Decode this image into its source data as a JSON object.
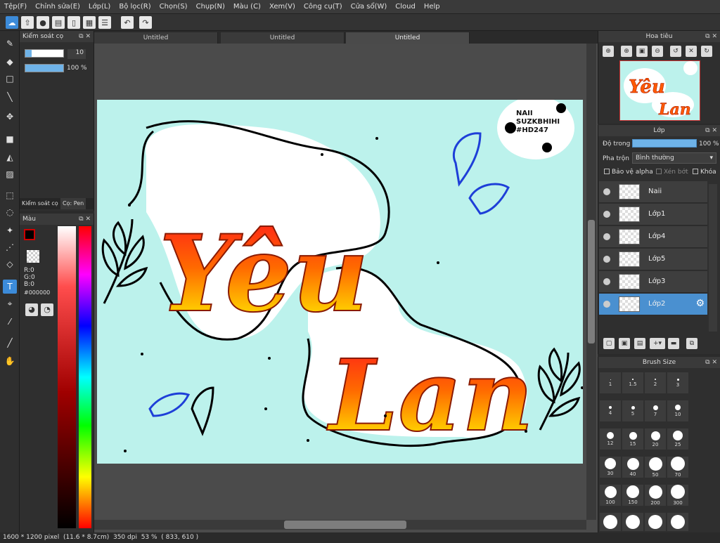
{
  "menu": [
    "Tệp(F)",
    "Chỉnh sửa(E)",
    "Lớp(L)",
    "Bộ lọc(R)",
    "Chọn(S)",
    "Chụp(N)",
    "Màu (C)",
    "Xem(V)",
    "Công cụ(T)",
    "Cửa sổ(W)",
    "Cloud",
    "Help"
  ],
  "toolbar": {
    "undo_icon": "undo-arrow-icon",
    "redo_icon": "redo-arrow-icon"
  },
  "brush_control": {
    "title": "Kiểm soát cọ",
    "size_value": "10",
    "opacity_value": "100 %",
    "tabs": [
      "Kiểm soát cọ",
      "Cọ: Pen"
    ]
  },
  "color_panel": {
    "title": "Màu",
    "r": "R:0",
    "g": "G:0",
    "b": "B:0",
    "hex": "#000000",
    "fg_color": "#000000",
    "bg_color": "#ffffff"
  },
  "document_tabs": [
    "Untitled",
    "Untitled",
    "Untitled"
  ],
  "artwork": {
    "title_line1": "Yêu",
    "title_line2": "Lan",
    "signature_line1": "NAII",
    "signature_line2": "SUZKBHIHI",
    "signature_line3": "#HD247"
  },
  "status": {
    "pixels": "1600 * 1200 pixel",
    "size_cm": "(11.6 * 8.7cm)",
    "dpi": "350 dpi",
    "zoom": "53 %",
    "cursor": "( 833, 610 )"
  },
  "navigator": {
    "title": "Hoa tiêu"
  },
  "layer_panel": {
    "title": "Lớp",
    "opacity_label": "Độ trong",
    "opacity_value": "100 %",
    "blend_label": "Pha trộn",
    "blend_value": "Bình thường",
    "protect_alpha": "Bảo vệ alpha",
    "clipping": "Xén bớt",
    "lock": "Khóa",
    "layers": [
      "Naii",
      "Lớp1",
      "Lớp4",
      "Lớp5",
      "Lớp3",
      "Lớp2"
    ],
    "selected_layer": "Lớp2"
  },
  "brush_size": {
    "title": "Brush Size",
    "sizes": [
      "1",
      "1.5",
      "2",
      "3",
      "4",
      "5",
      "7",
      "10",
      "12",
      "15",
      "20",
      "25",
      "30",
      "40",
      "50",
      "70",
      "100",
      "150",
      "200",
      "300"
    ]
  },
  "colors": {
    "accent": "#3c8bd9",
    "canvas_bg": "#bcf2ec",
    "selected_layer": "#4a90d0"
  }
}
